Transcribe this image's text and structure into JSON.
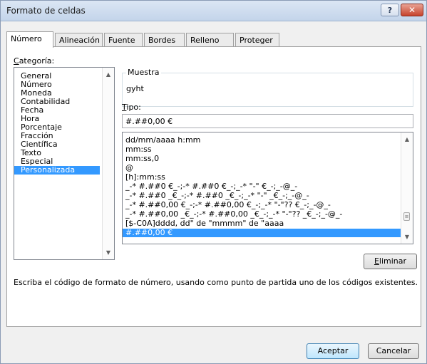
{
  "window": {
    "title": "Formato de celdas",
    "help_label": "?",
    "close_label": "✕"
  },
  "tabs": [
    {
      "label": "Número",
      "active": true
    },
    {
      "label": "Alineación",
      "active": false
    },
    {
      "label": "Fuente",
      "active": false
    },
    {
      "label": "Bordes",
      "active": false
    },
    {
      "label": "Relleno",
      "active": false
    },
    {
      "label": "Proteger",
      "active": false
    }
  ],
  "category": {
    "label_accel": "C",
    "label_rest": "ategoría:",
    "items": [
      "General",
      "Número",
      "Moneda",
      "Contabilidad",
      "Fecha",
      "Hora",
      "Porcentaje",
      "Fracción",
      "Científica",
      "Texto",
      "Especial",
      "Personalizada"
    ],
    "selected": "Personalizada"
  },
  "sample": {
    "label": "Muestra",
    "value": "gyht"
  },
  "type": {
    "label_accel": "T",
    "label_rest": "ipo:",
    "value": "#.##0,00 €"
  },
  "formats": {
    "items": [
      "dd/mm/aaaa h:mm",
      "mm:ss",
      "mm:ss,0",
      "@",
      "[h]:mm:ss",
      "_-* #.##0 €_-;-* #.##0 €_-;_-* \"-\" €_-;_-@_-",
      "_-* #.##0 _€_-;-* #.##0 _€_-;_-* \"-\" _€_-;_-@_-",
      "_-* #.##0,00 €_-;-* #.##0,00 €_-;_-* \"-\"?? €_-;_-@_-",
      "_-* #.##0,00 _€_-;-* #.##0,00 _€_-;_-* \"-\"?? _€_-;_-@_-",
      "[$-C0A]dddd, dd\" de \"mmmm\" de \"aaaa",
      "#.##0,00 €"
    ],
    "selected": "#.##0,00 €"
  },
  "delete_button": {
    "accel": "E",
    "rest": "liminar"
  },
  "description": "Escriba el código de formato de número, usando como punto de partida uno de los códigos existentes.",
  "footer": {
    "ok_label": "Aceptar",
    "cancel_label": "Cancelar"
  },
  "colors": {
    "selection": "#3399ff",
    "title_bar": "#c3d4ea",
    "close_button": "#c7432c"
  }
}
